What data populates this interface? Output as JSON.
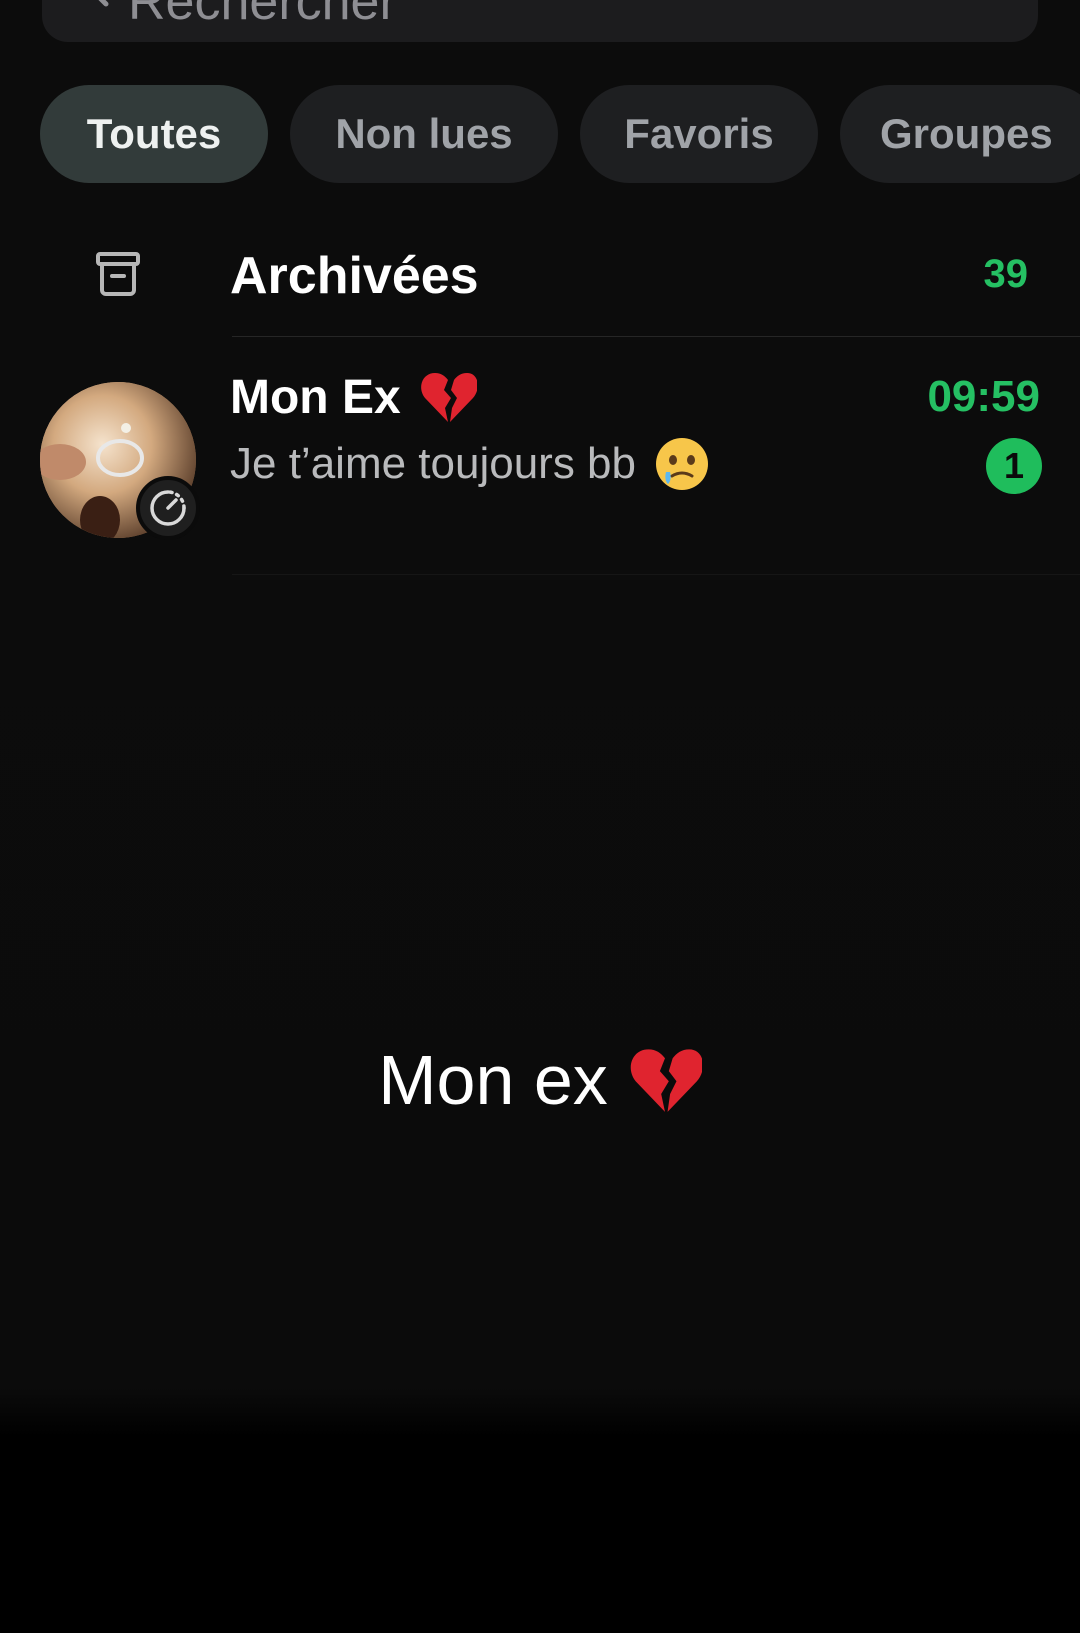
{
  "search": {
    "placeholder": "Rechercher"
  },
  "filters": [
    {
      "label": "Toutes",
      "active": true
    },
    {
      "label": "Non lues",
      "active": false
    },
    {
      "label": "Favoris",
      "active": false
    },
    {
      "label": "Groupes",
      "active": false
    }
  ],
  "archived": {
    "label": "Archivées",
    "count": "39",
    "icon": "archive-box-icon"
  },
  "chats": [
    {
      "name": "Mon Ex",
      "name_emoji": "broken-heart",
      "preview": "Je t’aime toujours bb",
      "preview_emoji": "face-holding-back-tears",
      "time": "09:59",
      "unread": "1",
      "avatar": "photo-ring-avatar",
      "status_icon": "disappearing-timer-icon"
    }
  ],
  "overlay": {
    "caption": "Mon ex",
    "caption_emoji": "broken-heart"
  },
  "colors": {
    "background": "#0b0b0b",
    "accent_green": "#25c063",
    "chip_bg": "#1e1f21",
    "chip_active_bg": "#323b3a",
    "muted_text": "#b9babc"
  }
}
